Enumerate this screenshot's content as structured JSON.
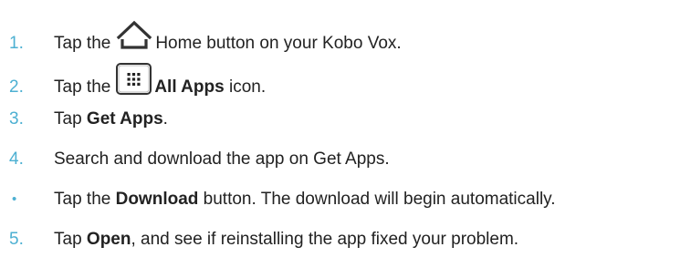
{
  "steps": [
    {
      "marker": "1.",
      "pre": "Tap the",
      "icon": "home-icon",
      "bold": "",
      "post": "Home button on your Kobo Vox."
    },
    {
      "marker": "2.",
      "pre": "Tap the",
      "icon": "all-apps-grid-icon",
      "bold": "All Apps",
      "post": " icon."
    },
    {
      "marker": "3.",
      "pre": "Tap ",
      "bold": "Get Apps",
      "post": "."
    },
    {
      "marker": "4.",
      "pre": "Search and download the app on Get Apps.",
      "bold": "",
      "post": ""
    },
    {
      "marker": "•",
      "pre": "Tap the ",
      "bold": "Download",
      "post": " button. The download will begin automatically."
    },
    {
      "marker": "5.",
      "pre": "Tap ",
      "bold": "Open",
      "post": ", and see if reinstalling the app fixed your problem."
    }
  ],
  "colors": {
    "marker": "#4db0d2",
    "text": "#222222"
  }
}
